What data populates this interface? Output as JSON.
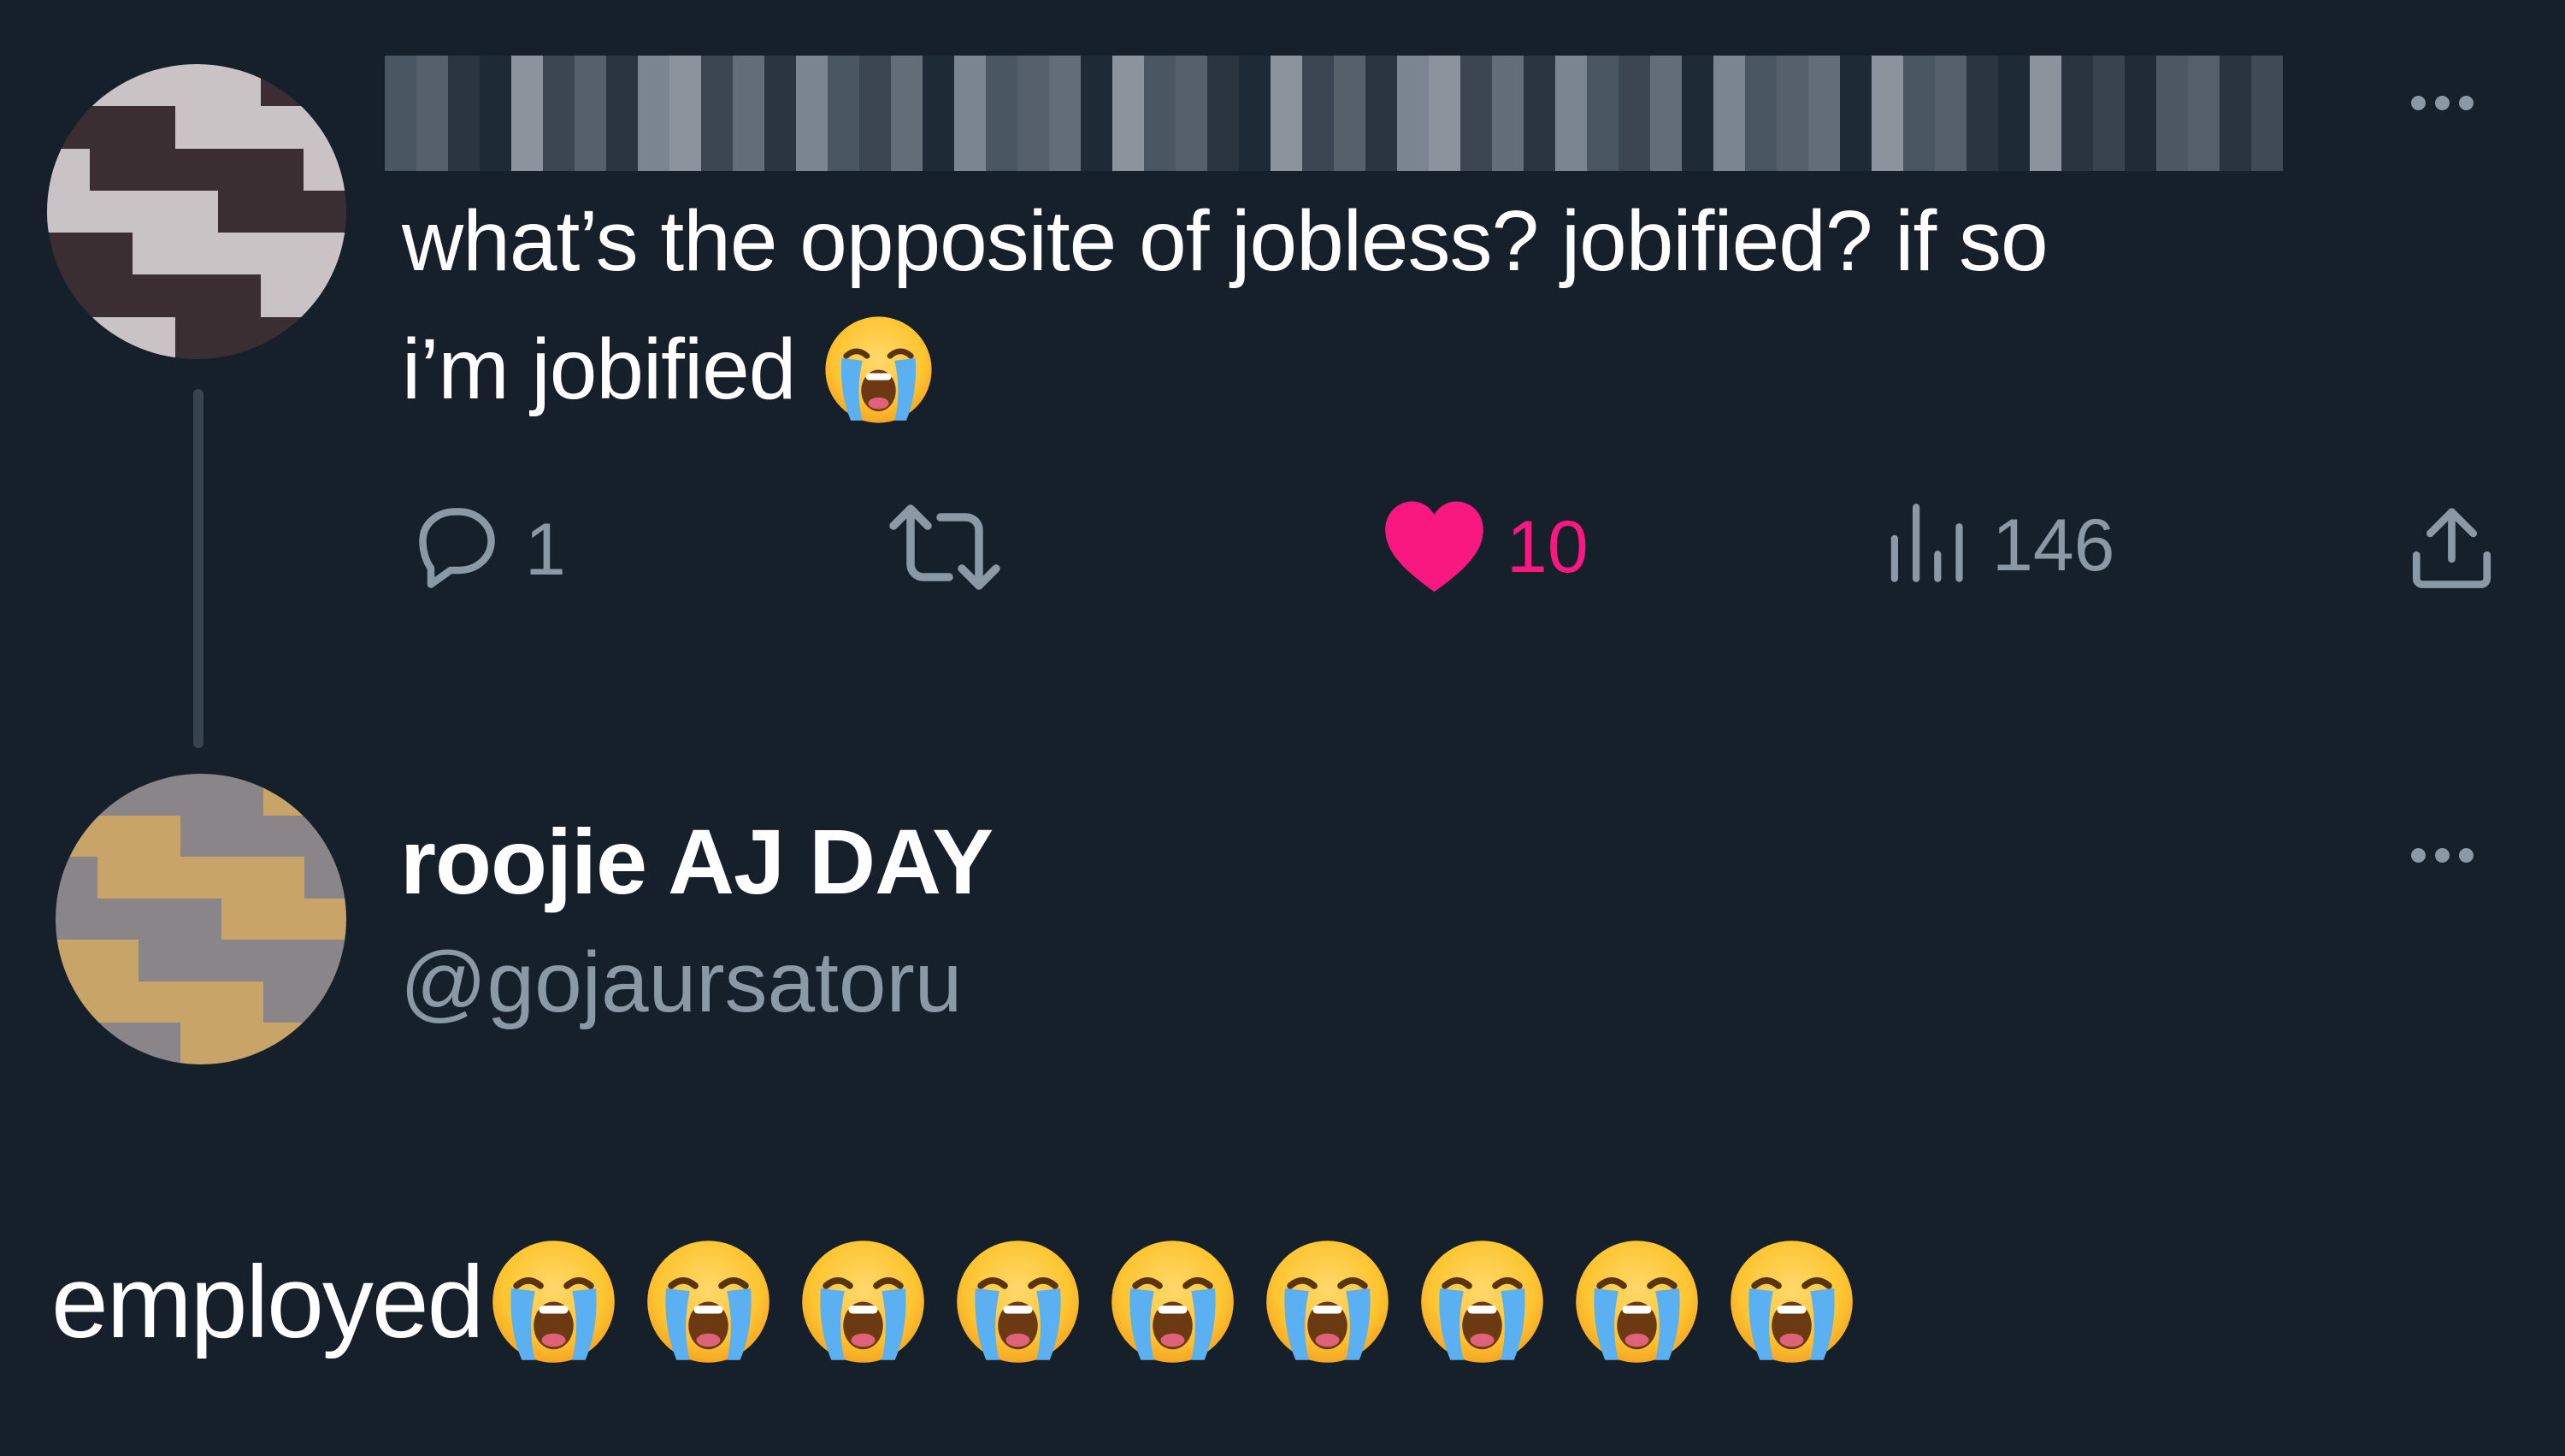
{
  "theme": {
    "background": "#15202b",
    "text_primary": "#ffffff",
    "text_secondary": "#8b98a5",
    "like_color": "#f91880",
    "thread_line": "#38444d"
  },
  "original_tweet": {
    "author_display_name": "",
    "author_name_censored": true,
    "more_icon": "more-horizontal-icon",
    "text_line_1": "what’s the opposite of jobless? jobified? if so",
    "text_line_2": "i’m jobified",
    "text_emoji": "loudly-crying-face",
    "actions": {
      "reply": {
        "icon": "reply-icon",
        "count": "1"
      },
      "retweet": {
        "icon": "retweet-icon",
        "count": ""
      },
      "like": {
        "icon": "heart-filled-icon",
        "count": "10",
        "liked": true
      },
      "views": {
        "icon": "views-chart-icon",
        "count": "146"
      },
      "share": {
        "icon": "share-icon"
      }
    }
  },
  "reply_tweet": {
    "author_display_name": "roojie AJ DAY",
    "author_handle": "@gojaursatoru",
    "more_icon": "more-horizontal-icon",
    "text": "employed",
    "emoji": "loudly-crying-face",
    "emoji_count": 9
  }
}
